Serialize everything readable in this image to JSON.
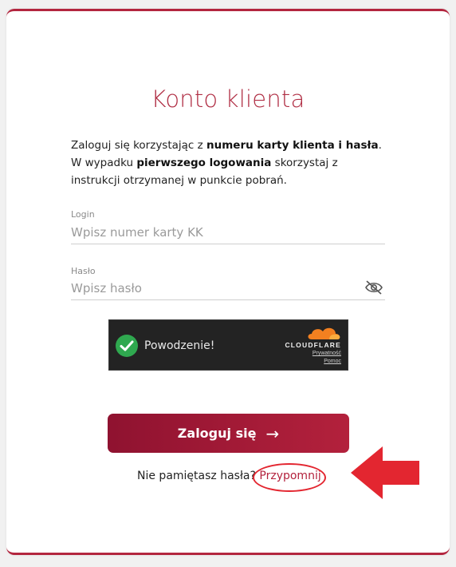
{
  "title": "Konto klienta",
  "intro": {
    "part1": "Zaloguj się korzystając z ",
    "bold1": "numeru karty klienta i hasła",
    "part2": ". W wypadku ",
    "bold2": "pierwszego logowania",
    "part3": " skorzystaj z instrukcji otrzymanej w punkcie pobrań."
  },
  "login": {
    "label": "Login",
    "placeholder": "Wpisz numer karty KK",
    "value": ""
  },
  "password": {
    "label": "Hasło",
    "placeholder": "Wpisz hasło",
    "value": "",
    "toggle_icon": "eye-slash-icon"
  },
  "captcha": {
    "status": "Powodzenie!",
    "brand": "CLOUDFLARE",
    "privacy": "Prywatność",
    "help": "Pomoc"
  },
  "submit": {
    "label": "Zaloguj się",
    "arrow": "→"
  },
  "forgot": {
    "text": "Nie pamiętasz hasła?",
    "link": "Przypomnij"
  },
  "colors": {
    "brand": "#b3213c",
    "annotation": "#e32630",
    "success": "#2fa84f"
  }
}
